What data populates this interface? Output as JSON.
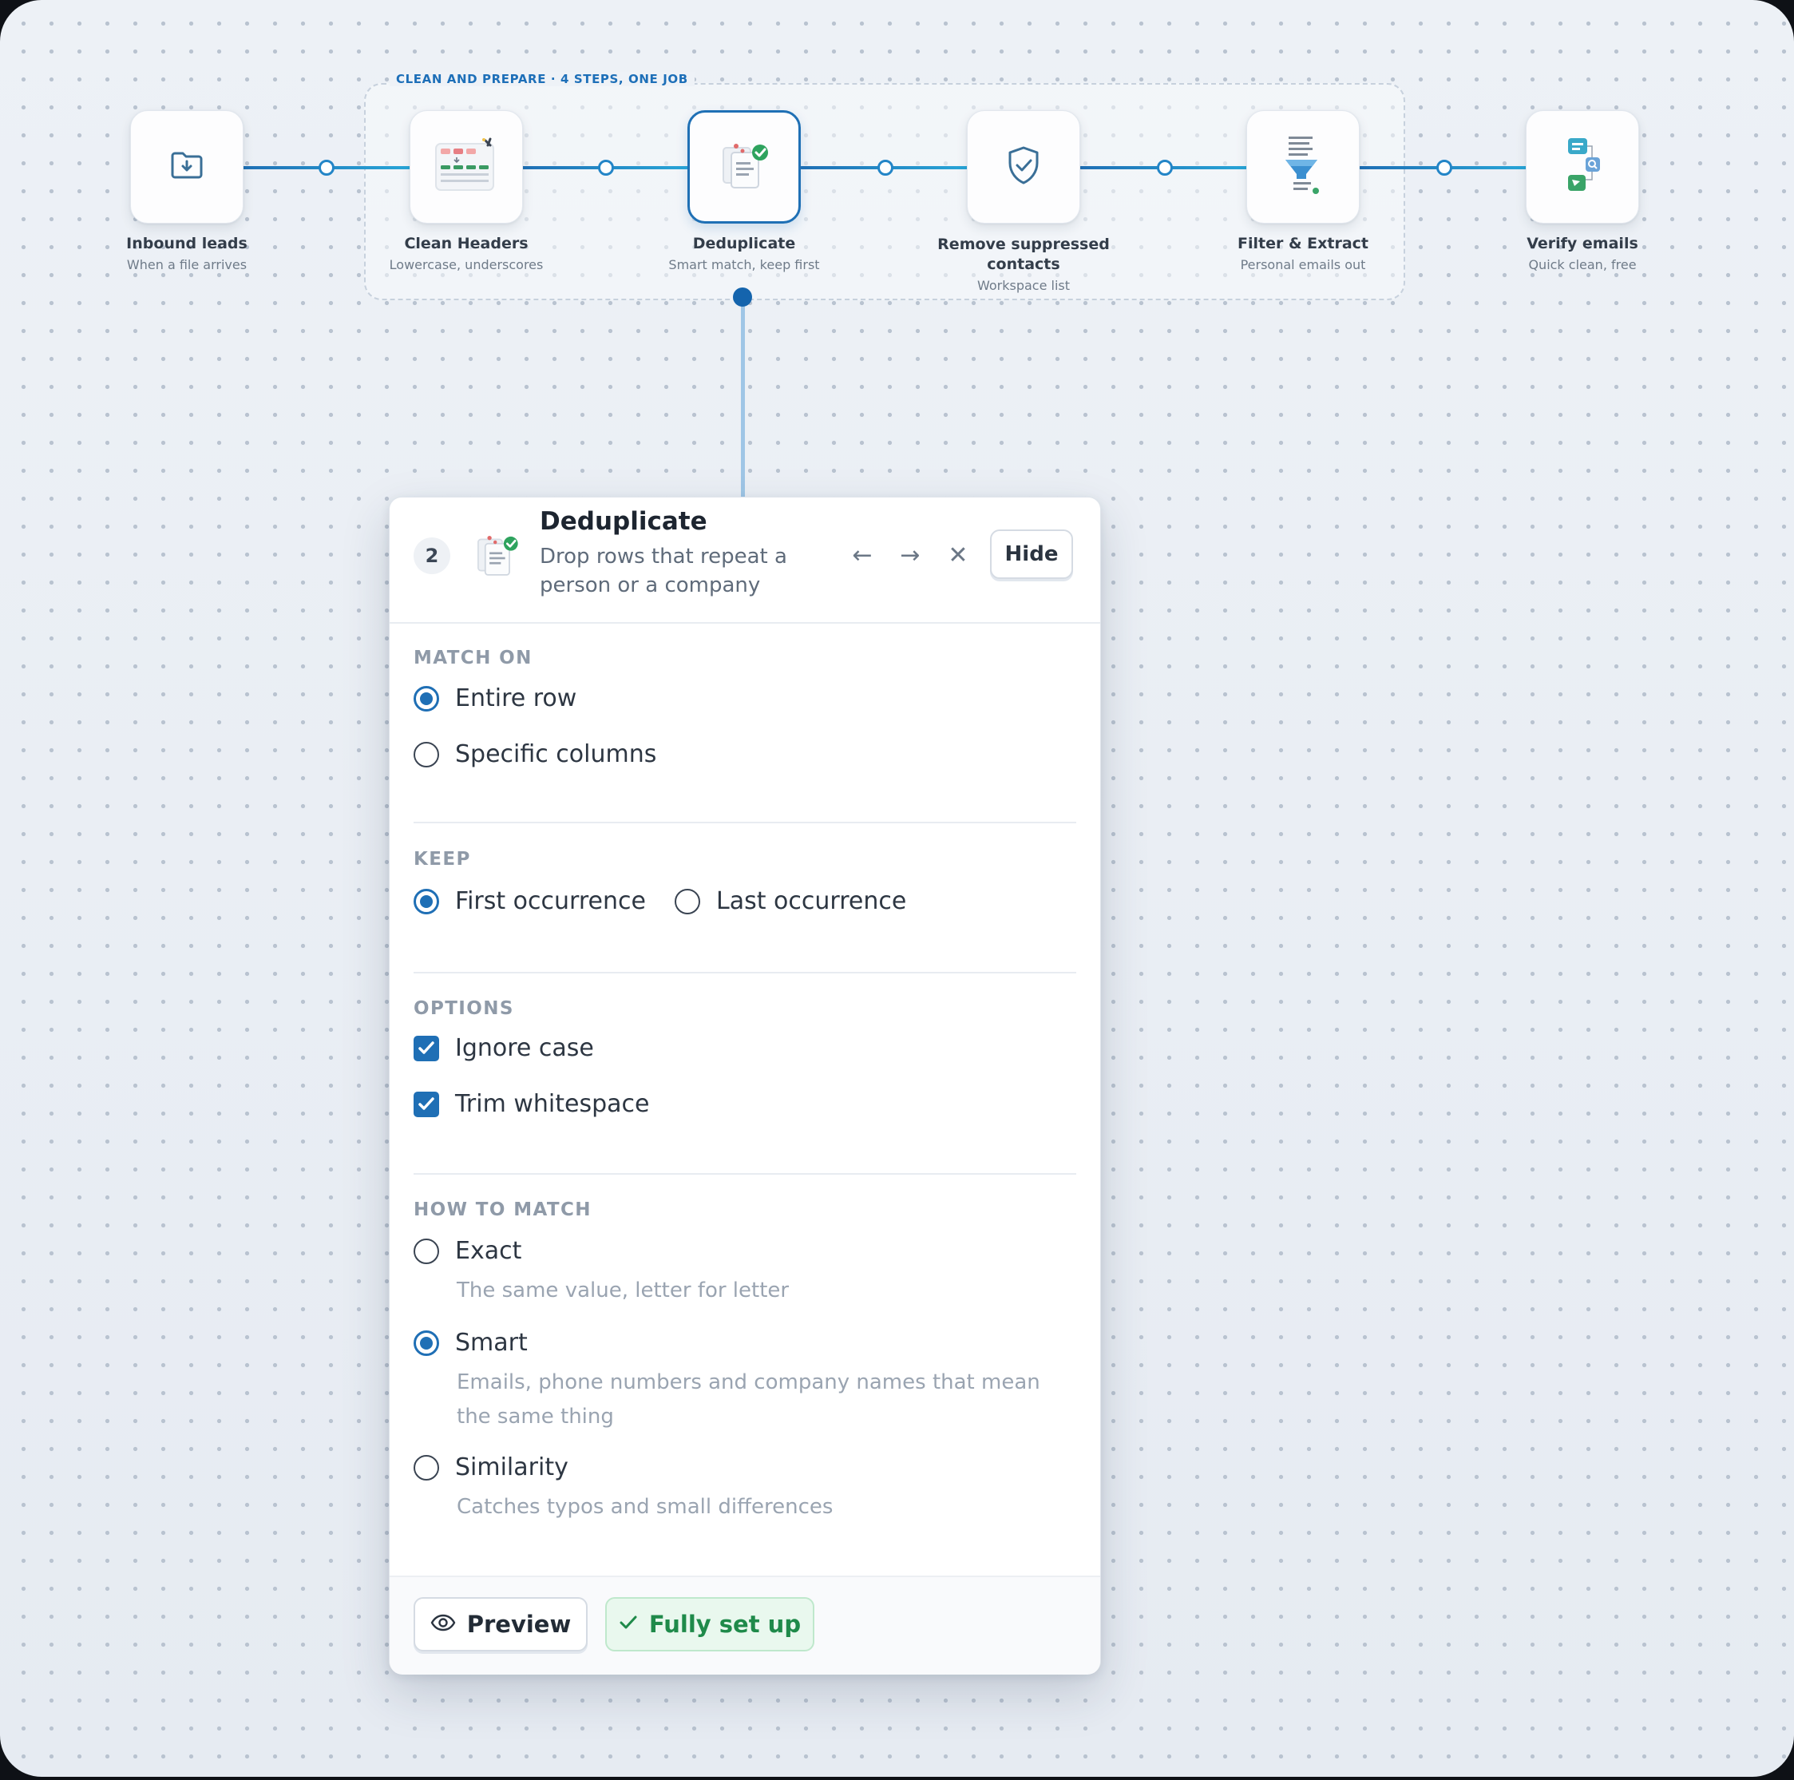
{
  "flow": {
    "group_label": "CLEAN AND PREPARE · 4 STEPS, ONE JOB",
    "nodes": [
      {
        "title": "Inbound leads",
        "subtitle": "When a file arrives",
        "icon": "folder-download-icon"
      },
      {
        "title": "Clean Headers",
        "subtitle": "Lowercase, underscores",
        "icon": "table-headers-icon"
      },
      {
        "title": "Deduplicate",
        "subtitle": "Smart match, keep first",
        "icon": "documents-check-icon",
        "active": true
      },
      {
        "title": "Remove suppressed contacts",
        "subtitle": "Workspace list",
        "icon": "shield-check-icon"
      },
      {
        "title": "Filter & Extract",
        "subtitle": "Personal emails out",
        "icon": "funnel-icon"
      },
      {
        "title": "Verify emails",
        "subtitle": "Quick clean, free",
        "icon": "verify-flow-icon"
      }
    ]
  },
  "panel": {
    "step_number": "2",
    "title": "Deduplicate",
    "description": "Drop rows that repeat a person or a company",
    "hide_label": "Hide",
    "icons": {
      "prev": "arrow-left-icon",
      "next": "arrow-right-icon",
      "close": "close-icon"
    },
    "match_on": {
      "label": "MATCH ON",
      "options": [
        {
          "label": "Entire row",
          "selected": true
        },
        {
          "label": "Specific columns",
          "selected": false
        }
      ]
    },
    "keep": {
      "label": "KEEP",
      "options": [
        {
          "label": "First occurrence",
          "selected": true
        },
        {
          "label": "Last occurrence",
          "selected": false
        }
      ]
    },
    "options": {
      "label": "OPTIONS",
      "items": [
        {
          "label": "Ignore case",
          "checked": true
        },
        {
          "label": "Trim whitespace",
          "checked": true
        }
      ]
    },
    "how_to_match": {
      "label": "HOW TO MATCH",
      "options": [
        {
          "label": "Exact",
          "help": "The same value, letter for letter",
          "selected": false
        },
        {
          "label": "Smart",
          "help": "Emails, phone numbers and company names that mean the same thing",
          "selected": true
        },
        {
          "label": "Similarity",
          "help": "Catches typos and small differences",
          "selected": false
        }
      ]
    },
    "footer": {
      "preview_label": "Preview",
      "status_label": "Fully set up"
    }
  },
  "colors": {
    "accent": "#1f6fb5",
    "success": "#1f8a4a",
    "canvas": "#e9eef5"
  }
}
